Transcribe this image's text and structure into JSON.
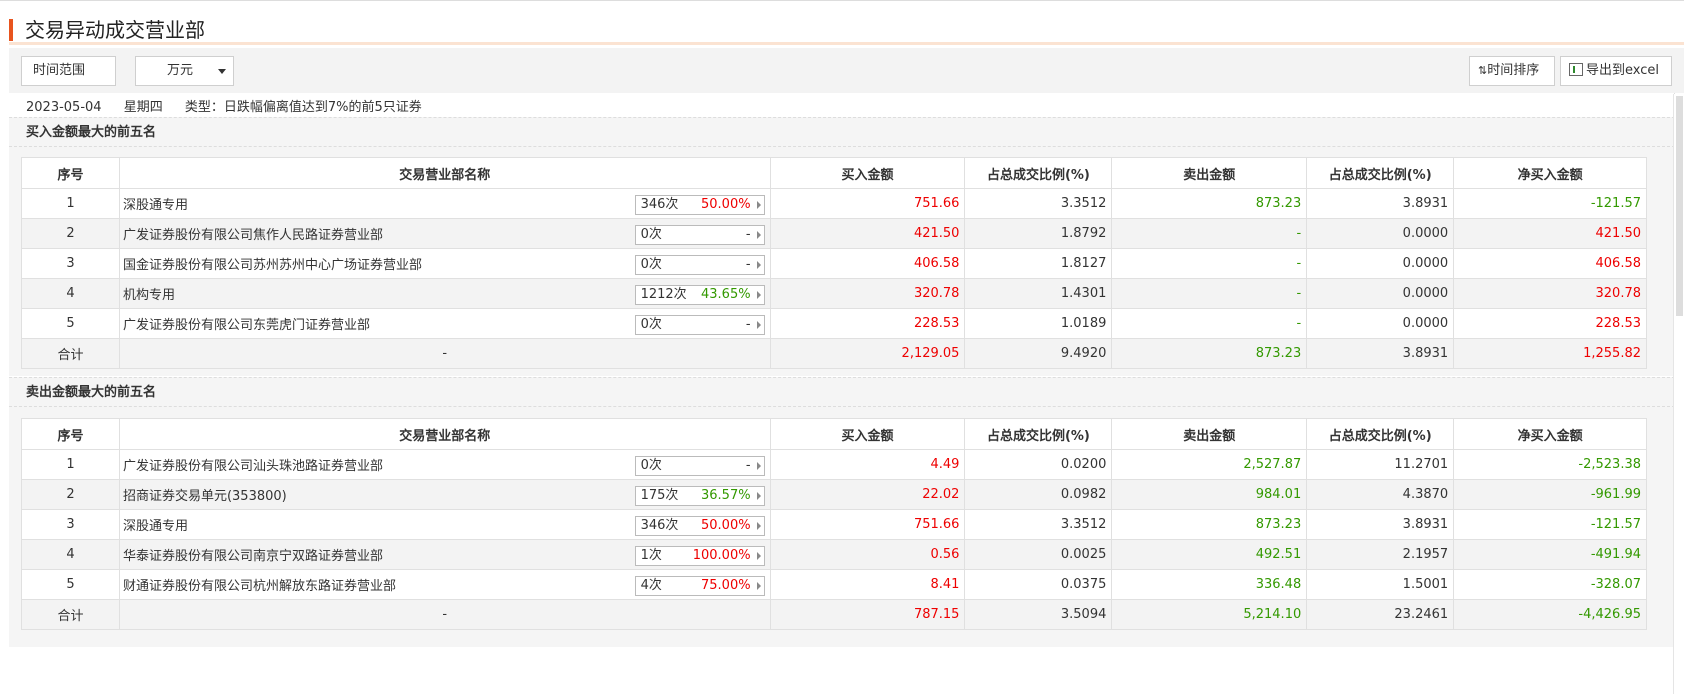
{
  "header": {
    "title": "交易异动成交营业部"
  },
  "toolbar": {
    "range_label": "时间范围",
    "unit_label": "万元",
    "sort_label": "时间排序",
    "excel_label": "导出到excel"
  },
  "info": {
    "date": "2023-05-04",
    "weekday": "星期四",
    "type": "类型：日跌幅偏离值达到7%的前5只证券"
  },
  "columns": [
    "序号",
    "交易营业部名称",
    "买入金额",
    "占总成交比例(%)",
    "卖出金额",
    "占总成交比例(%)",
    "净买入金额"
  ],
  "buy_section": {
    "title": "买入金额最大的前五名",
    "rows": [
      {
        "idx": "1",
        "name": "深股通专用",
        "times": "346次",
        "pct": "50.00%",
        "pct_color": "red",
        "buy": "751.66",
        "buy_ratio": "3.3512",
        "sell": "873.23",
        "sell_ratio": "3.8931",
        "net": "-121.57",
        "net_color": "green"
      },
      {
        "idx": "2",
        "name": "广发证券股份有限公司焦作人民路证券营业部",
        "times": "0次",
        "pct": "-",
        "pct_color": "gray",
        "buy": "421.50",
        "buy_ratio": "1.8792",
        "sell": "-",
        "sell_ratio": "0.0000",
        "net": "421.50",
        "net_color": "red"
      },
      {
        "idx": "3",
        "name": "国金证券股份有限公司苏州苏州中心广场证券营业部",
        "times": "0次",
        "pct": "-",
        "pct_color": "gray",
        "buy": "406.58",
        "buy_ratio": "1.8127",
        "sell": "-",
        "sell_ratio": "0.0000",
        "net": "406.58",
        "net_color": "red"
      },
      {
        "idx": "4",
        "name": "机构专用",
        "times": "1212次",
        "pct": "43.65%",
        "pct_color": "green",
        "buy": "320.78",
        "buy_ratio": "1.4301",
        "sell": "-",
        "sell_ratio": "0.0000",
        "net": "320.78",
        "net_color": "red"
      },
      {
        "idx": "5",
        "name": "广发证券股份有限公司东莞虎门证券营业部",
        "times": "0次",
        "pct": "-",
        "pct_color": "gray",
        "buy": "228.53",
        "buy_ratio": "1.0189",
        "sell": "-",
        "sell_ratio": "0.0000",
        "net": "228.53",
        "net_color": "red"
      }
    ],
    "total": {
      "label": "合计",
      "name": "-",
      "buy": "2,129.05",
      "buy_ratio": "9.4920",
      "sell": "873.23",
      "sell_ratio": "3.8931",
      "net": "1,255.82",
      "net_color": "red"
    }
  },
  "sell_section": {
    "title": "卖出金额最大的前五名",
    "rows": [
      {
        "idx": "1",
        "name": "广发证券股份有限公司汕头珠池路证券营业部",
        "times": "0次",
        "pct": "-",
        "pct_color": "gray",
        "buy": "4.49",
        "buy_ratio": "0.0200",
        "sell": "2,527.87",
        "sell_ratio": "11.2701",
        "net": "-2,523.38",
        "net_color": "green"
      },
      {
        "idx": "2",
        "name": "招商证券交易单元(353800)",
        "times": "175次",
        "pct": "36.57%",
        "pct_color": "green",
        "buy": "22.02",
        "buy_ratio": "0.0982",
        "sell": "984.01",
        "sell_ratio": "4.3870",
        "net": "-961.99",
        "net_color": "green"
      },
      {
        "idx": "3",
        "name": "深股通专用",
        "times": "346次",
        "pct": "50.00%",
        "pct_color": "red",
        "buy": "751.66",
        "buy_ratio": "3.3512",
        "sell": "873.23",
        "sell_ratio": "3.8931",
        "net": "-121.57",
        "net_color": "green"
      },
      {
        "idx": "4",
        "name": "华泰证券股份有限公司南京宁双路证券营业部",
        "times": "1次",
        "pct": "100.00%",
        "pct_color": "red",
        "buy": "0.56",
        "buy_ratio": "0.0025",
        "sell": "492.51",
        "sell_ratio": "2.1957",
        "net": "-491.94",
        "net_color": "green"
      },
      {
        "idx": "5",
        "name": "财通证券股份有限公司杭州解放东路证券营业部",
        "times": "4次",
        "pct": "75.00%",
        "pct_color": "red",
        "buy": "8.41",
        "buy_ratio": "0.0375",
        "sell": "336.48",
        "sell_ratio": "1.5001",
        "net": "-328.07",
        "net_color": "green"
      }
    ],
    "total": {
      "label": "合计",
      "name": "-",
      "buy": "787.15",
      "buy_ratio": "3.5094",
      "sell": "5,214.10",
      "sell_ratio": "23.2461",
      "net": "-4,426.95",
      "net_color": "green"
    }
  },
  "colors": {
    "accent": "#e8541e",
    "red": "#ee0000",
    "green": "#339900"
  }
}
